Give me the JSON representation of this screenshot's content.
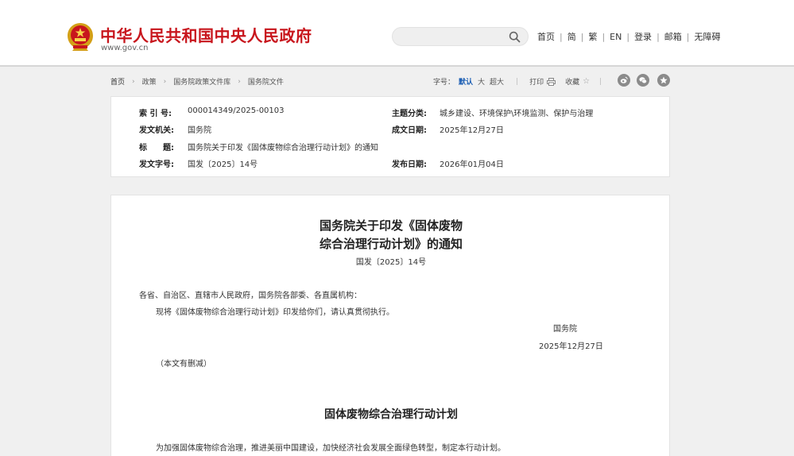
{
  "header": {
    "site_title": "中华人民共和国中央人民政府",
    "site_url": "www.gov.cn",
    "search_placeholder": "",
    "nav": [
      "首页",
      "简",
      "繁",
      "EN",
      "登录",
      "邮箱",
      "无障碍"
    ]
  },
  "breadcrumb": [
    "首页",
    "政策",
    "国务院政策文件库",
    "国务院文件"
  ],
  "tools": {
    "font_size_label": "字号：",
    "font_sizes": [
      "默认",
      "大",
      "超大"
    ],
    "active_font_size": "默认",
    "print_label": "打印",
    "favorite_label": "收藏",
    "share_icons": [
      "weibo-icon",
      "wechat-icon",
      "qzone-icon"
    ]
  },
  "meta": {
    "index_no_label": "索 引 号:",
    "index_no": "000014349/2025-00103",
    "category_label": "主题分类:",
    "category": "城乡建设、环境保护\\环境监测、保护与治理",
    "issuer_label": "发文机关:",
    "issuer": "国务院",
    "date_written_label": "成文日期:",
    "date_written": "2025年12月27日",
    "subject_label": "标　　题:",
    "subject": "国务院关于印发《固体废物综合治理行动计划》的通知",
    "doc_no_label": "发文字号:",
    "doc_no": "国发〔2025〕14号",
    "publish_date_label": "发布日期:",
    "publish_date": "2026年01月04日"
  },
  "article": {
    "title_line1": "国务院关于印发《固体废物",
    "title_line2": "综合治理行动计划》的通知",
    "doc_number": "国发〔2025〕14号",
    "addressee": "各省、自治区、直辖市人民政府，国务院各部委、各直属机构：",
    "body": "现将《固体废物综合治理行动计划》印发给你们，请认真贯彻执行。",
    "signature": "国务院",
    "sign_date": "2025年12月27日",
    "note": "（本文有删减）",
    "section_title": "固体废物综合治理行动计划",
    "intro": "为加强固体废物综合治理，推进美丽中国建设，加快经济社会发展全面绿色转型，制定本行动计划。"
  },
  "colors": {
    "brand_red": "#c8161d",
    "active_blue": "#1a5db3",
    "page_bg": "#f0f0f0"
  }
}
